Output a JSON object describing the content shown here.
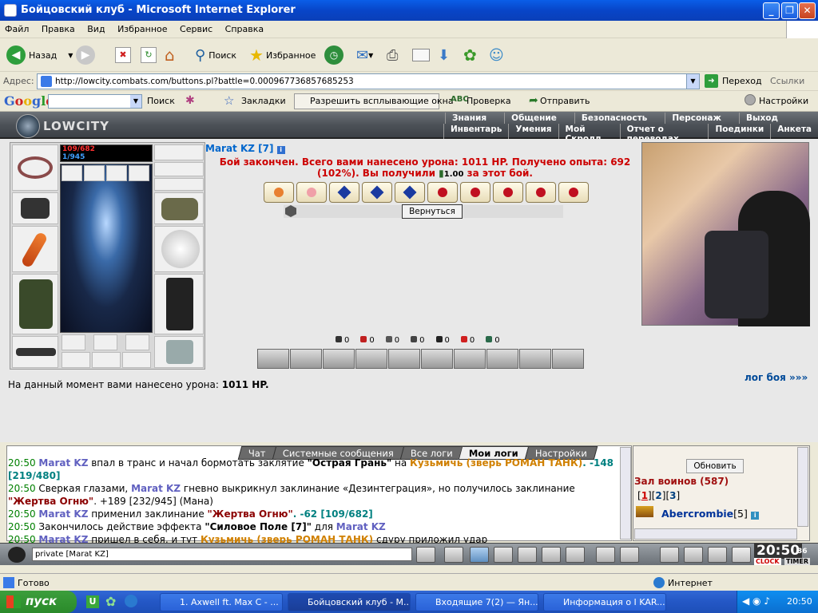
{
  "window": {
    "title": "Бойцовский клуб - Microsoft Internet Explorer"
  },
  "menu": [
    "Файл",
    "Правка",
    "Вид",
    "Избранное",
    "Сервис",
    "Справка"
  ],
  "toolbar": {
    "back": "Назад",
    "search": "Поиск",
    "favorites": "Избранное"
  },
  "address": {
    "label": "Адрес:",
    "url": "http://lowcity.combats.com/buttons.pl?battle=0.000967736857685253",
    "go": "Переход",
    "links": "Ссылки"
  },
  "google": {
    "logo": "Google",
    "search": "Поиск",
    "bookmarks": "Закладки",
    "popups": "Разрешить всплывающие окна",
    "spell": "Проверка",
    "send": "Отправить",
    "settings": "Настройки"
  },
  "game": {
    "logo": "LOWCITY",
    "nav_top": [
      "Знания",
      "Общение",
      "Безопасность",
      "Персонаж",
      "Выход"
    ],
    "nav_bottom": [
      "Инвентарь",
      "Умения",
      "Мой Скролл",
      "Отчет о переводах",
      "Поединки",
      "Анкета"
    ],
    "hp": "109/682",
    "mp": "1/945",
    "char_name": "Marat KZ [7]",
    "battle_text": "Бой закончен. Всего вами нанесено урона: 1011 HP. Получено опыта: 692 (102%). Вы получили",
    "battle_money": "1.00",
    "battle_text_end": "за этот бой.",
    "back_button": "Вернуться",
    "stats": [
      "0",
      "0",
      "0",
      "0",
      "0",
      "0",
      "0"
    ],
    "damage_label": "На данный момент вами нанесено урона:",
    "damage_value": "1011 HP.",
    "log_link": "лог боя »»»"
  },
  "chat": {
    "tabs": [
      "Чат",
      "Системные сообщения",
      "Все логи",
      "Мои логи",
      "Настройки"
    ],
    "lines": [
      {
        "time": "20:50",
        "name": "Marat KZ",
        "text": "впал в транс и начал бормотать заклятие ",
        "spell": "\"Острая Грань\"",
        "tail": " на ",
        "target": "Кузьмичь (зверь РОМАН ТАНК)",
        "extra": ". -148 [219/480]"
      },
      {
        "time": "20:50",
        "text": "Сверкая глазами, ",
        "name": "Marat KZ",
        "mid": " гневно выкрикнул заклинание «Дезинтеграция», но получилось заклинание ",
        "spell": "\"Жертва Огню\"",
        "extra": ". +189 [232/945] (Мана)"
      },
      {
        "time": "20:50",
        "name": "Marat KZ",
        "text": "применил заклинание ",
        "spell": "\"Жертва Огню\"",
        "extra": ". -62 [109/682]"
      },
      {
        "time": "20:50",
        "text": "Закончилось действие эффекта ",
        "spell": "\"Силовое Поле [7]\"",
        "mid": " для ",
        "name": "Marat KZ"
      },
      {
        "time": "20:50",
        "name": "Marat KZ",
        "text": "пришел в себя, и тут ",
        "target": "Кузьмичь (зверь РОМАН ТАНК)",
        "extra": " сдуру приложил удар"
      }
    ],
    "input_value": "private [Marat KZ]"
  },
  "room": {
    "refresh": "Обновить",
    "title": "Зал воинов (587)",
    "pages": [
      "1",
      "2",
      "3"
    ],
    "player": "Abercrombie",
    "player_level": "[5]"
  },
  "clock": {
    "time": "20:50",
    "seconds": "36",
    "clock_label": "CLOCK",
    "timer_label": "TIMER"
  },
  "status": {
    "left": "Готово",
    "right": "Интернет"
  },
  "taskbar": {
    "start": "пуск",
    "tasks": [
      "1. Axwell ft. Max C - ...",
      "Бойцовский клуб - M...",
      "Входящие 7(2) — Ян...",
      "Информация о I KAR..."
    ],
    "time": "20:50"
  }
}
